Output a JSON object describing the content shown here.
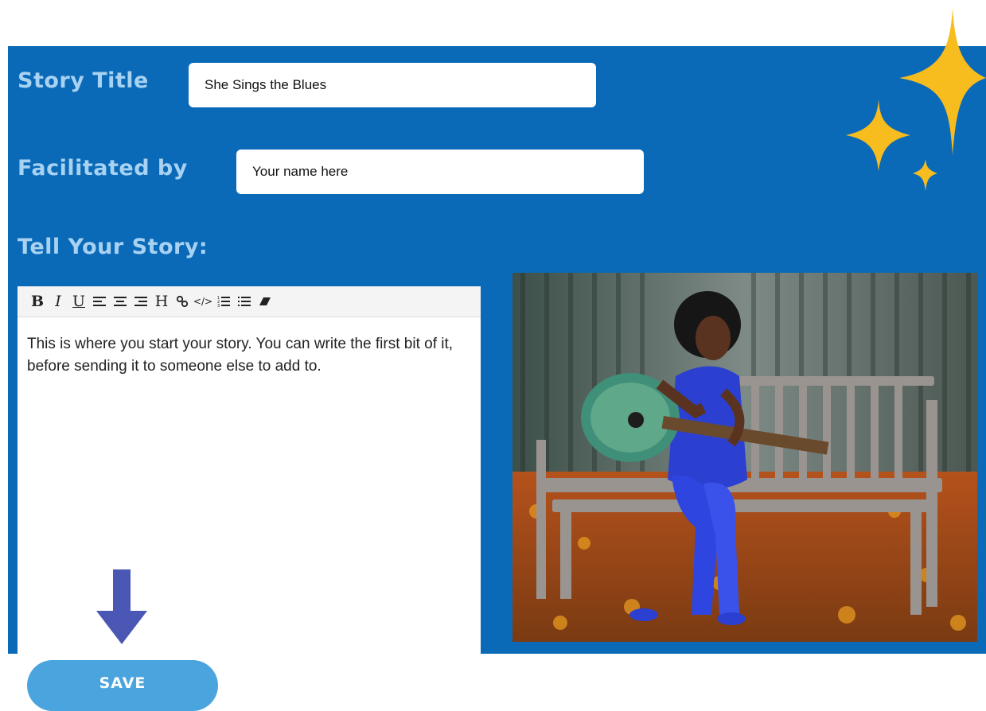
{
  "form": {
    "title_label": "Story Title",
    "title_value": "She Sings the Blues",
    "facilitator_label": "Facilitated by",
    "facilitator_value": "Your name here",
    "story_label": "Tell Your Story:",
    "story_text": "This is where you start your story. You can write the first bit of it, before sending it to someone else to add to."
  },
  "toolbar": {
    "items": [
      {
        "name": "bold-icon",
        "glyph": "B"
      },
      {
        "name": "italic-icon",
        "glyph": "I"
      },
      {
        "name": "underline-icon",
        "glyph": "U"
      },
      {
        "name": "align-left-icon",
        "glyph": "align-left"
      },
      {
        "name": "align-center-icon",
        "glyph": "align-center"
      },
      {
        "name": "align-right-icon",
        "glyph": "align-right"
      },
      {
        "name": "heading-icon",
        "glyph": "H"
      },
      {
        "name": "link-icon",
        "glyph": "link"
      },
      {
        "name": "code-icon",
        "glyph": "</>"
      },
      {
        "name": "ordered-list-icon",
        "glyph": "ordered-list"
      },
      {
        "name": "unordered-list-icon",
        "glyph": "unordered-list"
      },
      {
        "name": "eraser-icon",
        "glyph": "eraser"
      }
    ]
  },
  "actions": {
    "save_label": "SAVE"
  },
  "colors": {
    "panel": "#0a6ab8",
    "label": "#a8d2f2",
    "save_button": "#4aa4de",
    "arrow": "#4a57b5",
    "sparkle": "#f7bc1e"
  }
}
